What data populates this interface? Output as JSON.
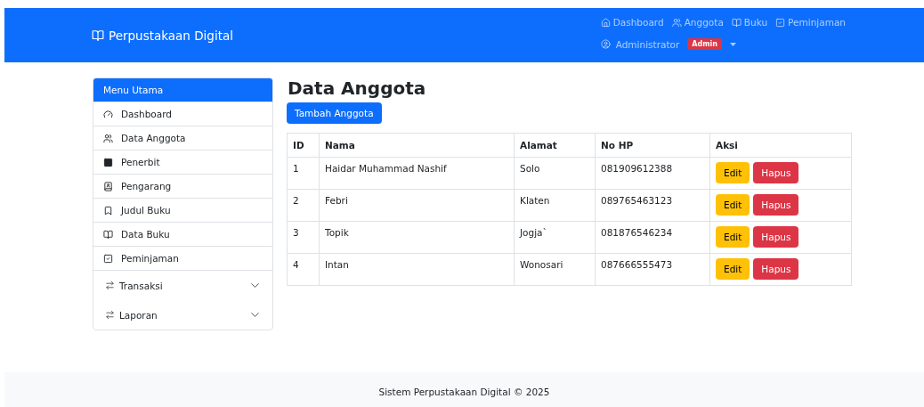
{
  "navbar": {
    "brand": "Perpustakaan Digital",
    "links": [
      {
        "label": "Dashboard"
      },
      {
        "label": "Anggota"
      },
      {
        "label": "Buku"
      },
      {
        "label": "Peminjaman"
      }
    ],
    "user": {
      "name": "Administrator",
      "badge": "Admin"
    }
  },
  "sidebar": {
    "title": "Menu Utama",
    "items": [
      {
        "label": "Dashboard",
        "kind": "link"
      },
      {
        "label": "Data Anggota",
        "kind": "link"
      },
      {
        "label": "Penerbit",
        "kind": "link"
      },
      {
        "label": "Pengarang",
        "kind": "link"
      },
      {
        "label": "Judul Buku",
        "kind": "link"
      },
      {
        "label": "Data Buku",
        "kind": "link"
      },
      {
        "label": "Peminjaman",
        "kind": "link"
      },
      {
        "label": "Transaksi",
        "kind": "dropdown",
        "expanded": false
      },
      {
        "label": "Laporan",
        "kind": "dropdown",
        "expanded": false
      }
    ]
  },
  "page": {
    "title": "Data Anggota",
    "add_button": "Tambah Anggota"
  },
  "table": {
    "columns": [
      "ID",
      "Nama",
      "Alamat",
      "No HP",
      "Aksi"
    ],
    "rows": [
      {
        "id": "1",
        "nama": "Haidar Muhammad Nashif",
        "alamat": "Solo",
        "no_hp": "081909612388",
        "actions": [
          "Edit",
          "Hapus"
        ]
      },
      {
        "id": "2",
        "nama": "Febri",
        "alamat": "Klaten",
        "no_hp": "089765463123",
        "actions": [
          "Edit",
          "Hapus"
        ]
      },
      {
        "id": "3",
        "nama": "Topik",
        "alamat": "Jogja`",
        "no_hp": "081876546234",
        "actions": [
          "Edit",
          "Hapus"
        ]
      },
      {
        "id": "4",
        "nama": "Intan",
        "alamat": "Wonosari",
        "no_hp": "087666555473",
        "actions": [
          "Edit",
          "Hapus"
        ]
      }
    ]
  },
  "footer": "Sistem Perpustakaan Digital © 2025"
}
